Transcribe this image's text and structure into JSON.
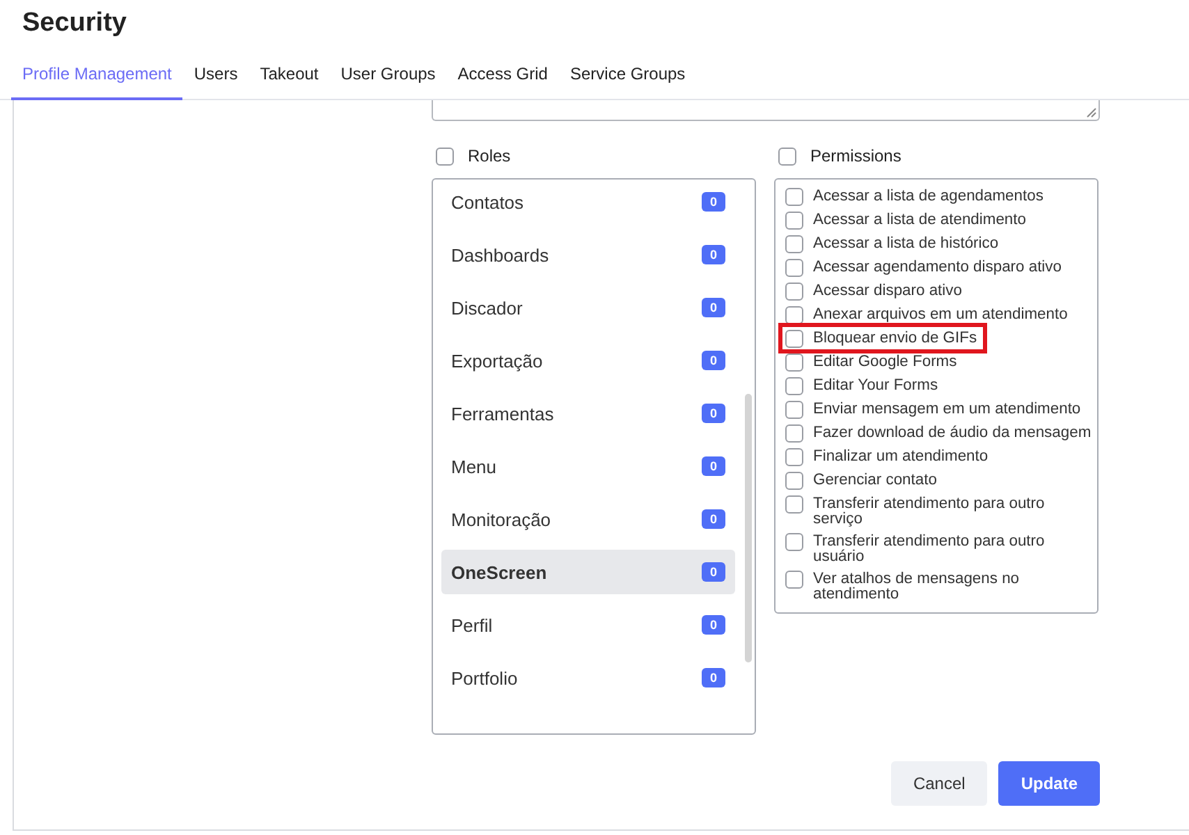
{
  "page": {
    "title": "Security"
  },
  "tabs": [
    {
      "label": "Profile Management",
      "selected": true
    },
    {
      "label": "Users",
      "selected": false
    },
    {
      "label": "Takeout",
      "selected": false
    },
    {
      "label": "User Groups",
      "selected": false
    },
    {
      "label": "Access Grid",
      "selected": false
    },
    {
      "label": "Service Groups",
      "selected": false
    }
  ],
  "roles": {
    "label": "Roles",
    "checked": false,
    "items": [
      {
        "name": "Contatos",
        "count": "0",
        "selected": false
      },
      {
        "name": "Dashboards",
        "count": "0",
        "selected": false
      },
      {
        "name": "Discador",
        "count": "0",
        "selected": false
      },
      {
        "name": "Exportação",
        "count": "0",
        "selected": false
      },
      {
        "name": "Ferramentas",
        "count": "0",
        "selected": false
      },
      {
        "name": "Menu",
        "count": "0",
        "selected": false
      },
      {
        "name": "Monitoração",
        "count": "0",
        "selected": false
      },
      {
        "name": "OneScreen",
        "count": "0",
        "selected": true
      },
      {
        "name": "Perfil",
        "count": "0",
        "selected": false
      },
      {
        "name": "Portfolio",
        "count": "0",
        "selected": false
      }
    ]
  },
  "permissions": {
    "label": "Permissions",
    "checked": false,
    "items": [
      {
        "label": "Acessar a lista de agendamentos",
        "checked": false,
        "highlighted": false
      },
      {
        "label": "Acessar a lista de atendimento",
        "checked": false,
        "highlighted": false
      },
      {
        "label": "Acessar a lista de histórico",
        "checked": false,
        "highlighted": false
      },
      {
        "label": "Acessar agendamento disparo ativo",
        "checked": false,
        "highlighted": false
      },
      {
        "label": "Acessar disparo ativo",
        "checked": false,
        "highlighted": false
      },
      {
        "label": "Anexar arquivos em um atendimento",
        "checked": false,
        "highlighted": false
      },
      {
        "label": "Bloquear envio de GIFs",
        "checked": false,
        "highlighted": true
      },
      {
        "label": "Editar Google Forms",
        "checked": false,
        "highlighted": false
      },
      {
        "label": "Editar Your Forms",
        "checked": false,
        "highlighted": false
      },
      {
        "label": "Enviar mensagem em um atendimento",
        "checked": false,
        "highlighted": false
      },
      {
        "label": "Fazer download de áudio da mensagem",
        "checked": false,
        "highlighted": false
      },
      {
        "label": "Finalizar um atendimento",
        "checked": false,
        "highlighted": false
      },
      {
        "label": "Gerenciar contato",
        "checked": false,
        "highlighted": false
      },
      {
        "label": "Transferir atendimento para outro serviço",
        "checked": false,
        "highlighted": false
      },
      {
        "label": "Transferir atendimento para outro usuário",
        "checked": false,
        "highlighted": false
      },
      {
        "label": "Ver atalhos de mensagens no atendimento",
        "checked": false,
        "highlighted": false
      }
    ]
  },
  "buttons": [
    {
      "label": "Cancel",
      "kind": "secondary"
    },
    {
      "label": "Update",
      "kind": "primary"
    }
  ]
}
